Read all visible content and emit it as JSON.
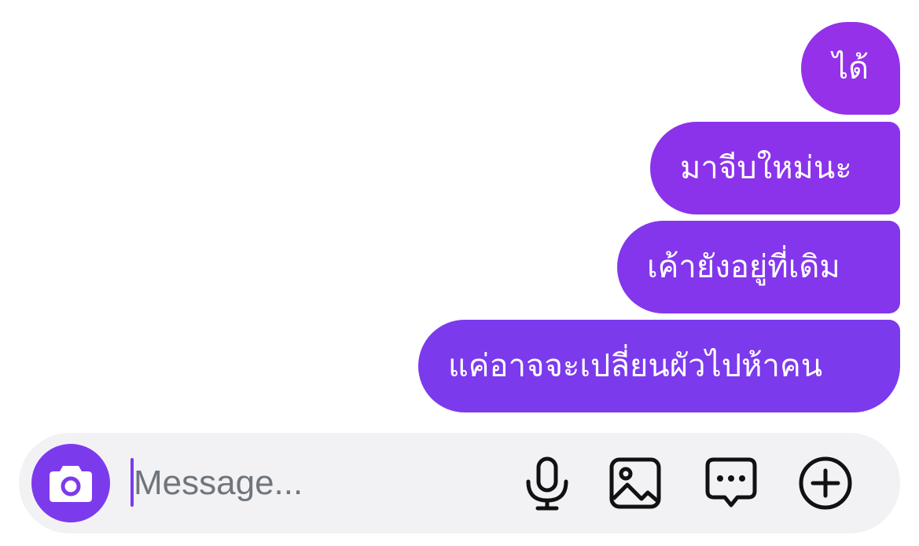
{
  "messages": [
    {
      "text": "ได้"
    },
    {
      "text": "มาจีบใหม่นะ"
    },
    {
      "text": "เค้ายังอยู่ที่เดิม"
    },
    {
      "text": "แค่อาจจะเปลี่ยนผัวไปห้าคน"
    }
  ],
  "composer": {
    "placeholder": "Message...",
    "value": ""
  },
  "icons": {
    "camera": "camera-icon",
    "microphone": "microphone-icon",
    "gallery": "image-icon",
    "chat": "chat-bubble-icon",
    "add": "plus-circle-icon"
  },
  "colors": {
    "bubble_top": "#9431e9",
    "bubble_bottom": "#7c3aed",
    "accent": "#7c3aed",
    "composer_bg": "#f2f2f5",
    "placeholder": "#6f757c"
  }
}
